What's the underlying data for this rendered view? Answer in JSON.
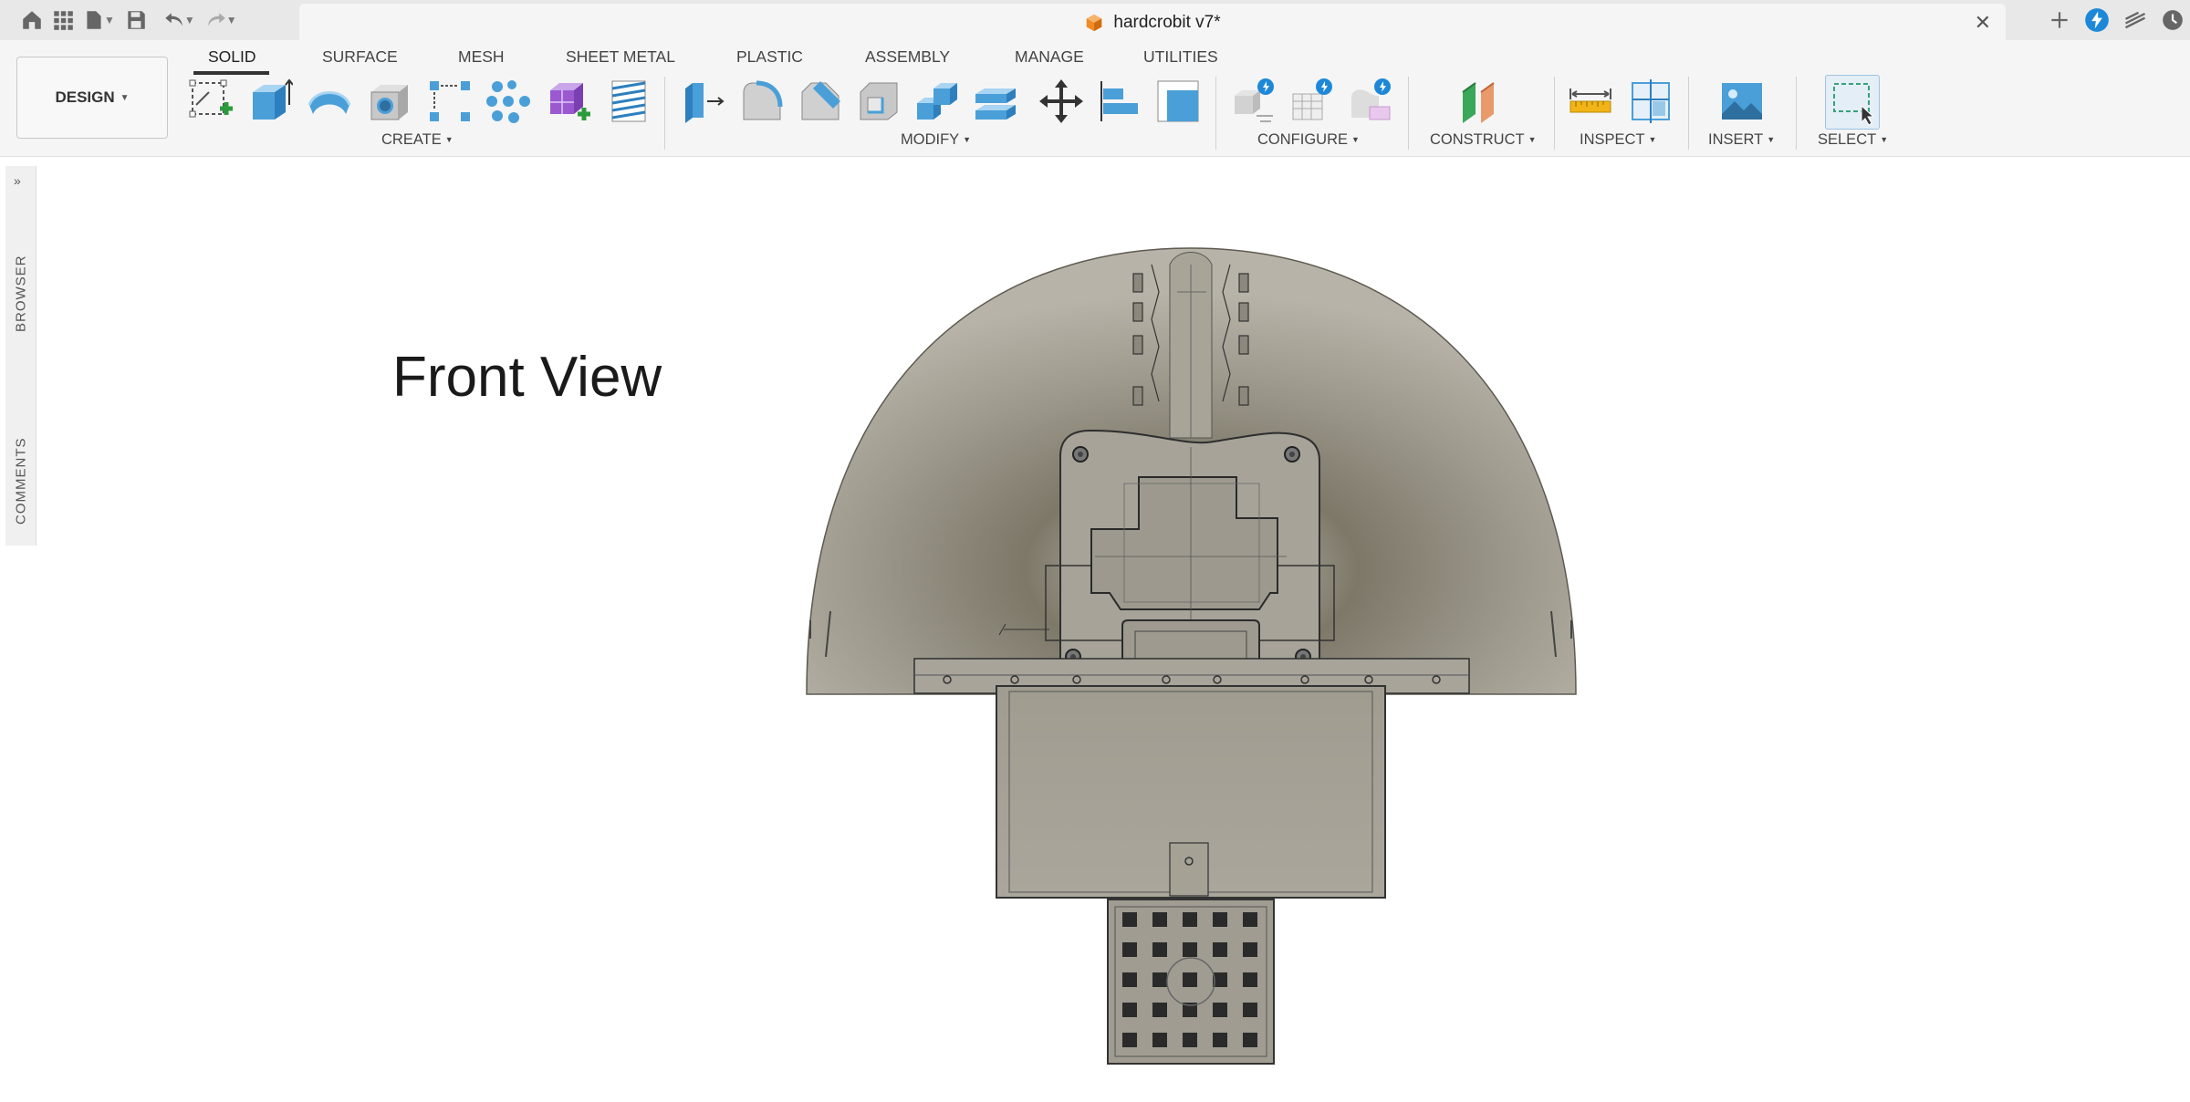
{
  "titlebar": {
    "document_title": "hardcrobit v7*",
    "icons": [
      "home-icon",
      "grid-icon",
      "file-icon",
      "save-icon",
      "undo-icon",
      "redo-icon"
    ],
    "right_icons": [
      "new-tab-icon",
      "extensions-icon",
      "job-status-icon",
      "clock-icon"
    ]
  },
  "workspace": {
    "label": "DESIGN"
  },
  "tabs": [
    {
      "label": "SOLID",
      "active": true
    },
    {
      "label": "SURFACE"
    },
    {
      "label": "MESH"
    },
    {
      "label": "SHEET METAL"
    },
    {
      "label": "PLASTIC"
    },
    {
      "label": "ASSEMBLY"
    },
    {
      "label": "MANAGE"
    },
    {
      "label": "UTILITIES"
    }
  ],
  "groups": {
    "create": "CREATE",
    "modify": "MODIFY",
    "configure": "CONFIGURE",
    "construct": "CONSTRUCT",
    "inspect": "INSPECT",
    "insert": "INSERT",
    "select": "SELECT"
  },
  "side_panel": {
    "browser": "BROWSER",
    "comments": "COMMENTS"
  },
  "viewport": {
    "view_label": "Front View"
  },
  "colors": {
    "accent": "#4a9fd8",
    "ribbon": "#f5f5f5",
    "model": "#a7a399"
  }
}
